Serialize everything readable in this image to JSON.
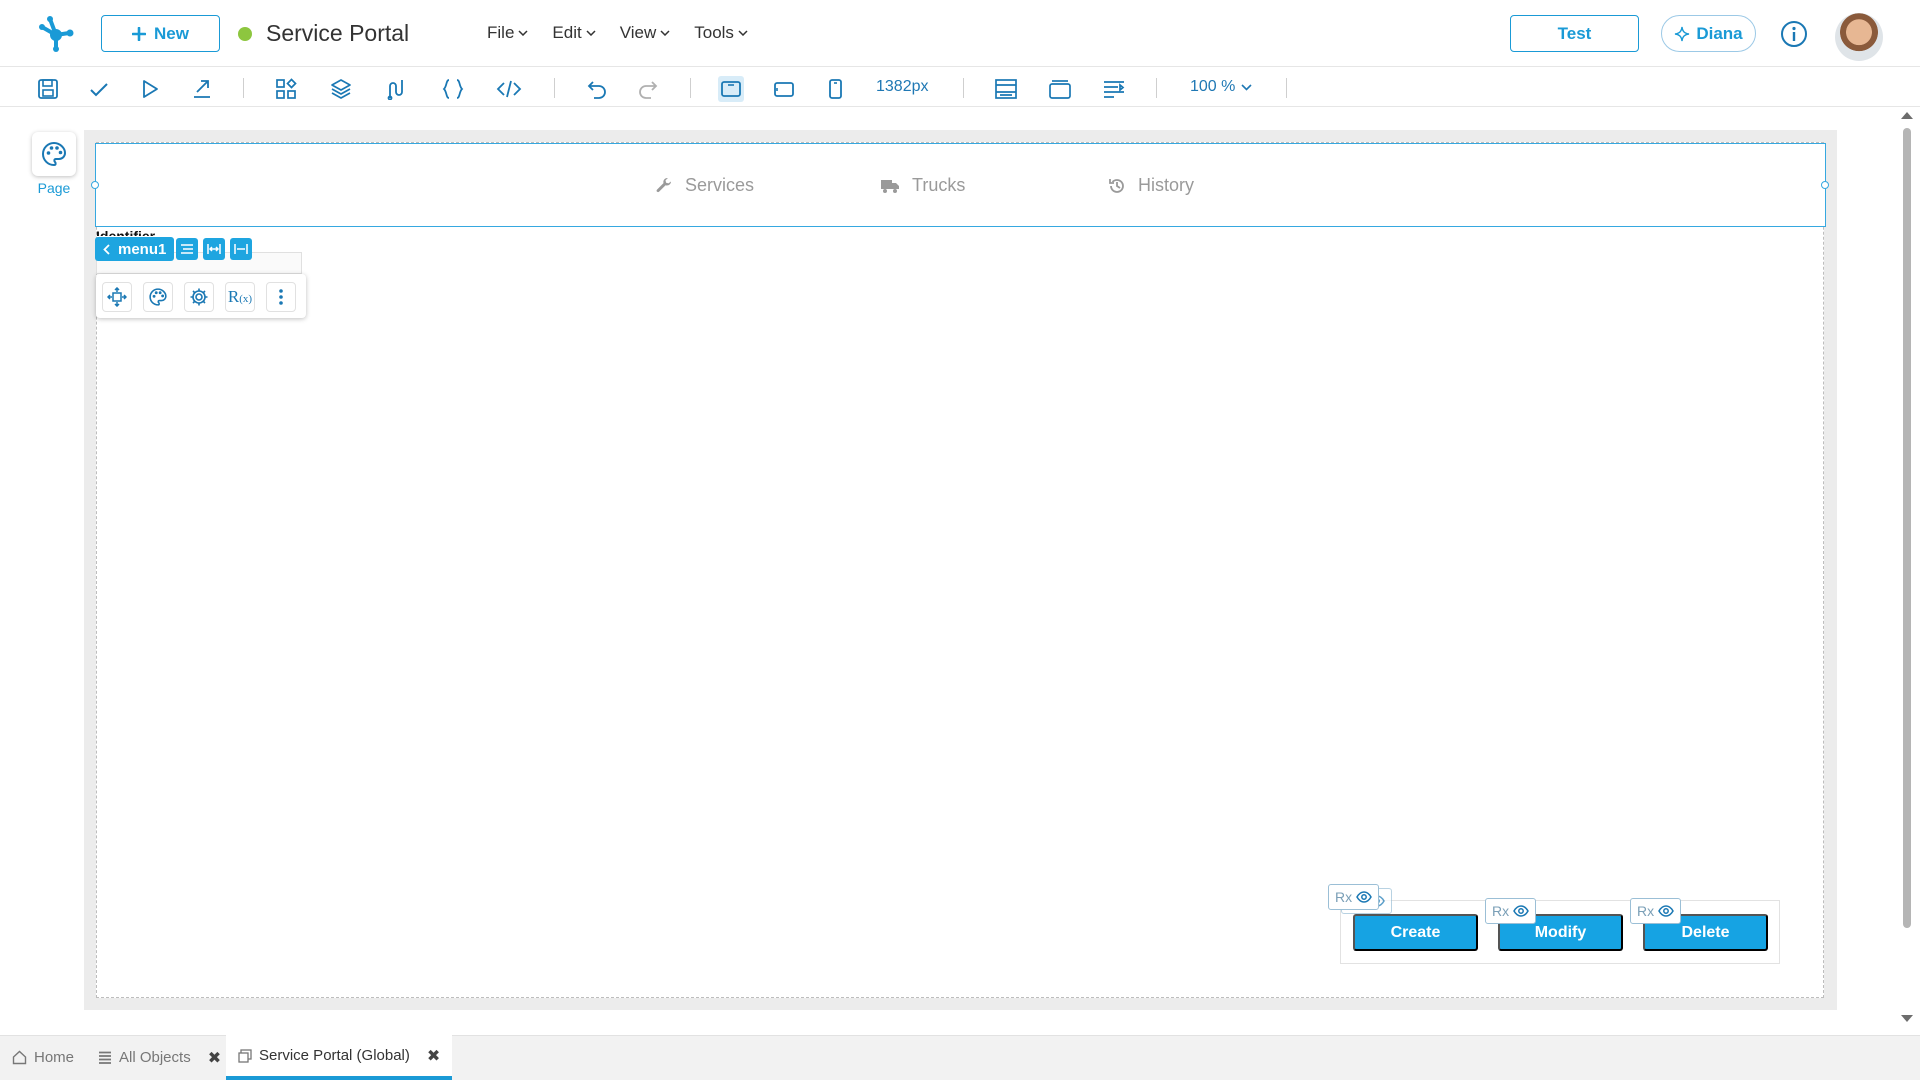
{
  "header": {
    "new_label": "New",
    "app_title": "Service Portal",
    "status_color": "#8dc63f",
    "menu": [
      {
        "label": "File"
      },
      {
        "label": "Edit"
      },
      {
        "label": "View"
      },
      {
        "label": "Tools"
      }
    ],
    "test_label": "Test",
    "assistant_label": "Diana"
  },
  "toolbar": {
    "icons": [
      "save-icon",
      "check-icon",
      "play-icon",
      "export-icon",
      "widgets-icon",
      "layers-icon",
      "flow-icon",
      "braces-icon",
      "code-icon",
      "undo-icon",
      "redo-icon",
      "desktop-view-icon",
      "tablet-view-icon",
      "mobile-view-icon",
      "template-icon",
      "window-icon",
      "align-icon"
    ],
    "width_readout": "1382px",
    "zoom": "100 %"
  },
  "palette": {
    "page_label": "Page"
  },
  "canvas": {
    "menu_tabs": [
      {
        "label": "Services",
        "icon": "wrench-icon"
      },
      {
        "label": "Trucks",
        "icon": "truck-icon"
      },
      {
        "label": "History",
        "icon": "history-icon"
      }
    ],
    "identifier_label": "Identifier",
    "component_chip": "menu1",
    "actions": [
      {
        "label": "Create"
      },
      {
        "label": "Modify"
      },
      {
        "label": "Delete"
      }
    ],
    "rx_label": "Rx",
    "accent_color": "#16a3e3"
  },
  "bottom_tabs": [
    {
      "label": "Home",
      "icon": "home-icon"
    },
    {
      "label": "All Objects",
      "icon": "list-icon"
    },
    {
      "label": "Service Portal (Global)",
      "icon": "page-icon"
    }
  ]
}
